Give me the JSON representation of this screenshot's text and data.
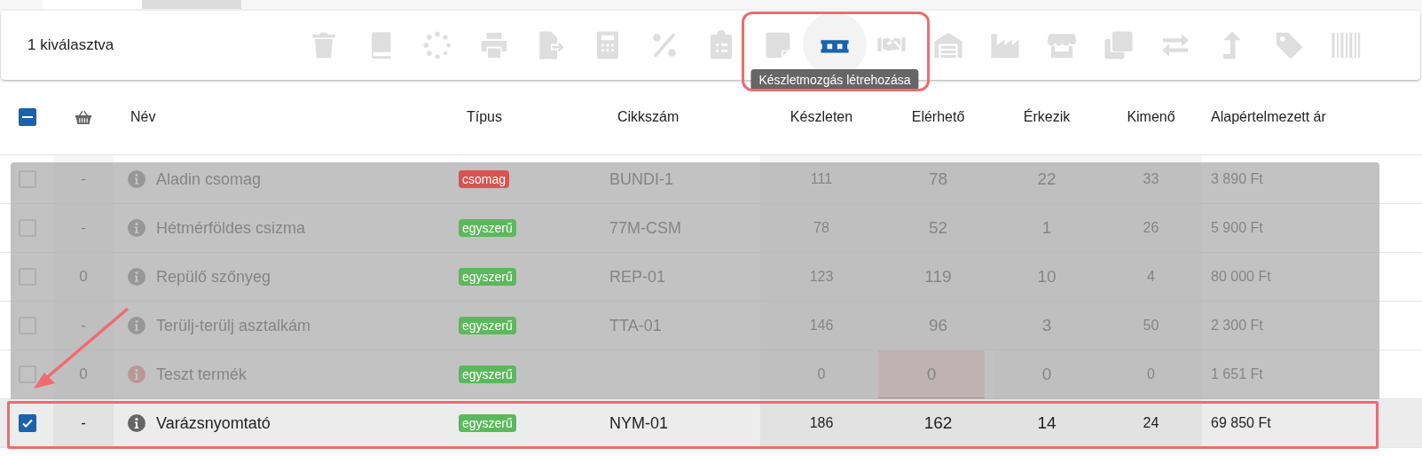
{
  "tabs": [
    {
      "selected": true
    },
    {
      "selected": false
    }
  ],
  "toolbar": {
    "selection_label": "1 kiválasztva",
    "actions": [
      {
        "kind": "trash",
        "selected": false
      },
      {
        "kind": "book",
        "selected": false
      },
      {
        "kind": "spinner",
        "selected": false
      },
      {
        "kind": "printer",
        "selected": false
      },
      {
        "kind": "file-export",
        "selected": false
      },
      {
        "kind": "calculator",
        "selected": false
      },
      {
        "kind": "percent",
        "selected": false
      },
      {
        "kind": "clipboard",
        "selected": false
      },
      {
        "kind": "note",
        "selected": false
      },
      {
        "kind": "pallet",
        "selected": true
      },
      {
        "kind": "handshake",
        "selected": false
      },
      {
        "kind": "warehouse",
        "selected": false
      },
      {
        "kind": "factory",
        "selected": false
      },
      {
        "kind": "store",
        "selected": false
      },
      {
        "kind": "copy",
        "selected": false
      },
      {
        "kind": "exchange",
        "selected": false
      },
      {
        "kind": "turn-up",
        "selected": false
      },
      {
        "kind": "tag",
        "selected": false
      },
      {
        "kind": "barcode",
        "selected": false
      }
    ],
    "tooltip": "Készletmozgás létrehozása"
  },
  "table": {
    "select_all": {
      "indeterminate": true
    },
    "columns": [
      "Név",
      "Típus",
      "Cikkszám",
      "Készleten",
      "Elérhető",
      "Érkezik",
      "Kimenő",
      "Alapértelmezett ár"
    ],
    "rows": [
      {
        "checked": false,
        "dimmed": true,
        "basket": "-",
        "warning": false,
        "name": "Aladin csomag",
        "type": "csomag",
        "color": "#d9534f",
        "sku": "BUNDI-1",
        "stock": "111",
        "available": "78",
        "available_alert": false,
        "incoming": "22",
        "outgoing": "33",
        "price": "3 890 Ft"
      },
      {
        "checked": false,
        "dimmed": true,
        "basket": "-",
        "warning": false,
        "name": "Hétmérföldes csizma",
        "type": "egyszerű",
        "color": "#5cb85c",
        "sku": "77M-CSM",
        "stock": "78",
        "available": "52",
        "available_alert": false,
        "incoming": "1",
        "outgoing": "26",
        "price": "5 900 Ft"
      },
      {
        "checked": false,
        "dimmed": true,
        "basket": "0",
        "warning": false,
        "name": "Repülő szőnyeg",
        "type": "egyszerű",
        "color": "#5cb85c",
        "sku": "REP-01",
        "stock": "123",
        "available": "119",
        "available_alert": false,
        "incoming": "10",
        "outgoing": "4",
        "price": "80 000 Ft"
      },
      {
        "checked": false,
        "dimmed": true,
        "basket": "-",
        "warning": false,
        "name": "Terülj-terülj asztalkám",
        "type": "egyszerű",
        "color": "#5cb85c",
        "sku": "TTA-01",
        "stock": "146",
        "available": "96",
        "available_alert": false,
        "incoming": "3",
        "outgoing": "50",
        "price": "2 300 Ft"
      },
      {
        "checked": false,
        "dimmed": true,
        "basket": "0",
        "warning": true,
        "name": "Teszt termék",
        "type": "egyszerű",
        "color": "#5cb85c",
        "stock": "0",
        "available": "0",
        "available_alert": true,
        "incoming": "0",
        "outgoing": "0",
        "price": "1 651 Ft"
      },
      {
        "checked": true,
        "dimmed": false,
        "basket": "-",
        "warning": false,
        "name": "Varázsnyomtató",
        "type": "egyszerű",
        "color": "#5cb85c",
        "sku": "NYM-01",
        "stock": "186",
        "available": "162",
        "available_alert": false,
        "incoming": "14",
        "outgoing": "24",
        "price": "69 850 Ft"
      }
    ]
  }
}
